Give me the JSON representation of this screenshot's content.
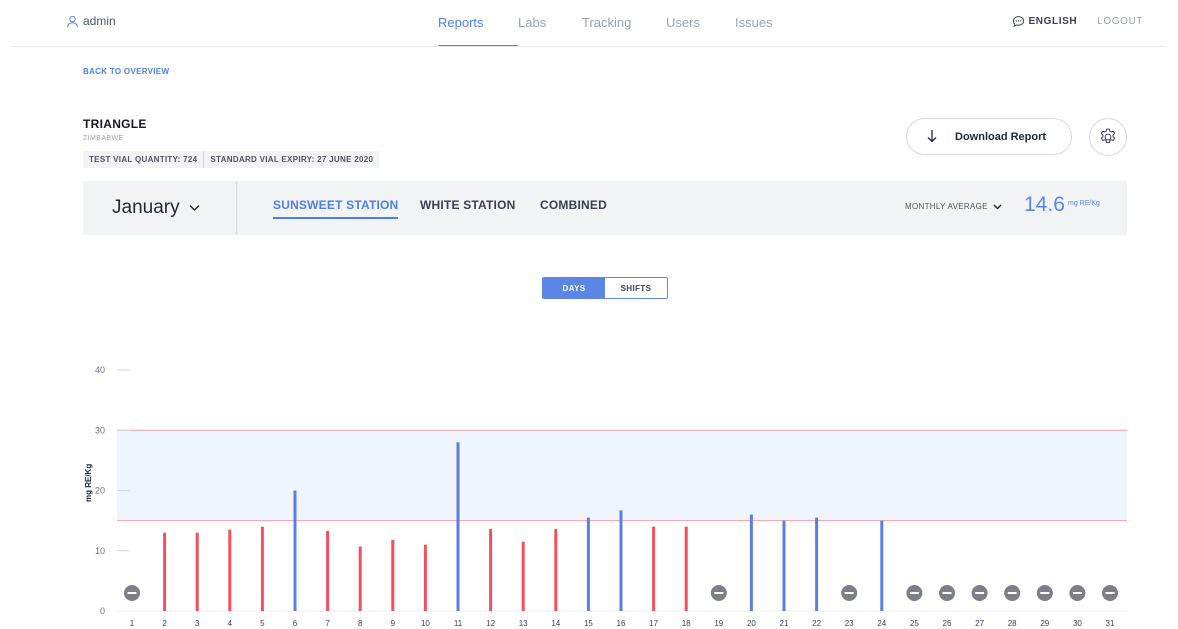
{
  "header": {
    "user": "admin",
    "tabs": [
      {
        "label": "Reports",
        "active": true
      },
      {
        "label": "Labs",
        "active": false
      },
      {
        "label": "Tracking",
        "active": false
      },
      {
        "label": "Users",
        "active": false
      },
      {
        "label": "Issues",
        "active": false
      }
    ],
    "language": "ENGLISH",
    "logout": "LOGOUT"
  },
  "back_link": "BACK TO OVERVIEW",
  "site": {
    "name": "TRIANGLE",
    "country": "ZIMBABWE",
    "test_vial_quantity": "TEST VIAL QUANTITY: 724",
    "standard_vial_expiry": "STANDARD VIAL EXPIRY: 27 JUNE 2020"
  },
  "actions": {
    "download_label": "Download Report"
  },
  "station_bar": {
    "month": "January",
    "stations": [
      {
        "label": "SUNSWEET STATION",
        "active": true
      },
      {
        "label": "WHITE STATION",
        "active": false
      },
      {
        "label": "COMBINED",
        "active": false
      }
    ],
    "average_label": "MONTHLY AVERAGE",
    "average_value": "14.6",
    "average_unit": "mg RE/Kg"
  },
  "view_toggle": {
    "options": [
      {
        "label": "DAYS",
        "active": true
      },
      {
        "label": "SHIFTS",
        "active": false
      }
    ]
  },
  "colors": {
    "accent": "#4f7fe0",
    "bar_in_range": "#5b7fe0",
    "bar_out_of_range": "#f0505f",
    "band_fill": "#eef5fd",
    "threshold_line": "#f3a0a8",
    "no_data_marker": "#7b8088"
  },
  "chart_data": {
    "type": "bar",
    "ylabel": "mg RE/Kg",
    "ylim": [
      0,
      40
    ],
    "yticks": [
      0,
      10,
      20,
      30,
      40
    ],
    "grid": false,
    "target_band": [
      15,
      30
    ],
    "categories": [
      "1",
      "2",
      "3",
      "4",
      "5",
      "6",
      "7",
      "8",
      "9",
      "10",
      "11",
      "12",
      "13",
      "14",
      "15",
      "16",
      "17",
      "18",
      "19",
      "20",
      "21",
      "22",
      "23",
      "24",
      "25",
      "26",
      "27",
      "28",
      "29",
      "30",
      "31"
    ],
    "values": [
      null,
      13,
      13,
      13.5,
      14,
      20,
      13.3,
      10.7,
      11.8,
      11,
      28,
      13.6,
      11.5,
      13.6,
      15.5,
      16.7,
      14,
      14,
      null,
      16,
      15,
      15.5,
      null,
      15,
      null,
      null,
      null,
      null,
      null,
      null,
      null
    ],
    "in_range": [
      false,
      false,
      false,
      false,
      false,
      true,
      false,
      false,
      false,
      false,
      true,
      false,
      false,
      false,
      true,
      true,
      false,
      false,
      false,
      true,
      true,
      true,
      false,
      true,
      false,
      false,
      false,
      false,
      false,
      false,
      false
    ]
  }
}
